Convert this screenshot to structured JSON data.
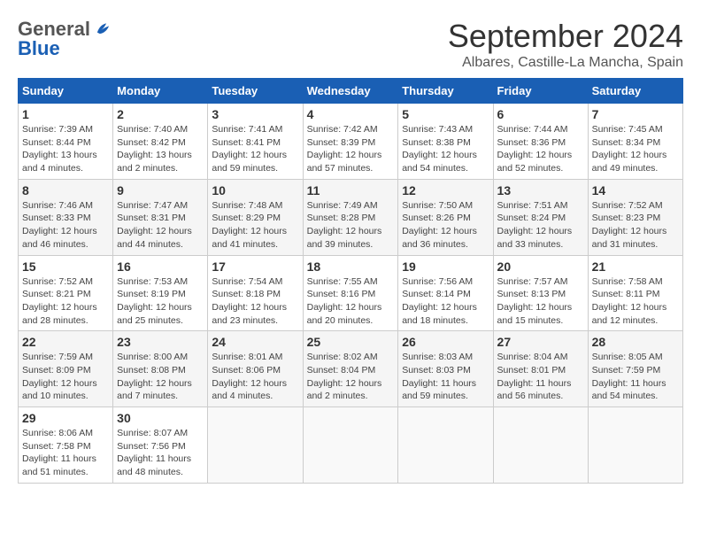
{
  "header": {
    "logo_general": "General",
    "logo_blue": "Blue",
    "month_title": "September 2024",
    "location": "Albares, Castille-La Mancha, Spain"
  },
  "days_of_week": [
    "Sunday",
    "Monday",
    "Tuesday",
    "Wednesday",
    "Thursday",
    "Friday",
    "Saturday"
  ],
  "weeks": [
    [
      {
        "day": "1",
        "sunrise": "7:39 AM",
        "sunset": "8:44 PM",
        "daylight": "13 hours and 4 minutes."
      },
      {
        "day": "2",
        "sunrise": "7:40 AM",
        "sunset": "8:42 PM",
        "daylight": "13 hours and 2 minutes."
      },
      {
        "day": "3",
        "sunrise": "7:41 AM",
        "sunset": "8:41 PM",
        "daylight": "12 hours and 59 minutes."
      },
      {
        "day": "4",
        "sunrise": "7:42 AM",
        "sunset": "8:39 PM",
        "daylight": "12 hours and 57 minutes."
      },
      {
        "day": "5",
        "sunrise": "7:43 AM",
        "sunset": "8:38 PM",
        "daylight": "12 hours and 54 minutes."
      },
      {
        "day": "6",
        "sunrise": "7:44 AM",
        "sunset": "8:36 PM",
        "daylight": "12 hours and 52 minutes."
      },
      {
        "day": "7",
        "sunrise": "7:45 AM",
        "sunset": "8:34 PM",
        "daylight": "12 hours and 49 minutes."
      }
    ],
    [
      {
        "day": "8",
        "sunrise": "7:46 AM",
        "sunset": "8:33 PM",
        "daylight": "12 hours and 46 minutes."
      },
      {
        "day": "9",
        "sunrise": "7:47 AM",
        "sunset": "8:31 PM",
        "daylight": "12 hours and 44 minutes."
      },
      {
        "day": "10",
        "sunrise": "7:48 AM",
        "sunset": "8:29 PM",
        "daylight": "12 hours and 41 minutes."
      },
      {
        "day": "11",
        "sunrise": "7:49 AM",
        "sunset": "8:28 PM",
        "daylight": "12 hours and 39 minutes."
      },
      {
        "day": "12",
        "sunrise": "7:50 AM",
        "sunset": "8:26 PM",
        "daylight": "12 hours and 36 minutes."
      },
      {
        "day": "13",
        "sunrise": "7:51 AM",
        "sunset": "8:24 PM",
        "daylight": "12 hours and 33 minutes."
      },
      {
        "day": "14",
        "sunrise": "7:52 AM",
        "sunset": "8:23 PM",
        "daylight": "12 hours and 31 minutes."
      }
    ],
    [
      {
        "day": "15",
        "sunrise": "7:52 AM",
        "sunset": "8:21 PM",
        "daylight": "12 hours and 28 minutes."
      },
      {
        "day": "16",
        "sunrise": "7:53 AM",
        "sunset": "8:19 PM",
        "daylight": "12 hours and 25 minutes."
      },
      {
        "day": "17",
        "sunrise": "7:54 AM",
        "sunset": "8:18 PM",
        "daylight": "12 hours and 23 minutes."
      },
      {
        "day": "18",
        "sunrise": "7:55 AM",
        "sunset": "8:16 PM",
        "daylight": "12 hours and 20 minutes."
      },
      {
        "day": "19",
        "sunrise": "7:56 AM",
        "sunset": "8:14 PM",
        "daylight": "12 hours and 18 minutes."
      },
      {
        "day": "20",
        "sunrise": "7:57 AM",
        "sunset": "8:13 PM",
        "daylight": "12 hours and 15 minutes."
      },
      {
        "day": "21",
        "sunrise": "7:58 AM",
        "sunset": "8:11 PM",
        "daylight": "12 hours and 12 minutes."
      }
    ],
    [
      {
        "day": "22",
        "sunrise": "7:59 AM",
        "sunset": "8:09 PM",
        "daylight": "12 hours and 10 minutes."
      },
      {
        "day": "23",
        "sunrise": "8:00 AM",
        "sunset": "8:08 PM",
        "daylight": "12 hours and 7 minutes."
      },
      {
        "day": "24",
        "sunrise": "8:01 AM",
        "sunset": "8:06 PM",
        "daylight": "12 hours and 4 minutes."
      },
      {
        "day": "25",
        "sunrise": "8:02 AM",
        "sunset": "8:04 PM",
        "daylight": "12 hours and 2 minutes."
      },
      {
        "day": "26",
        "sunrise": "8:03 AM",
        "sunset": "8:03 PM",
        "daylight": "11 hours and 59 minutes."
      },
      {
        "day": "27",
        "sunrise": "8:04 AM",
        "sunset": "8:01 PM",
        "daylight": "11 hours and 56 minutes."
      },
      {
        "day": "28",
        "sunrise": "8:05 AM",
        "sunset": "7:59 PM",
        "daylight": "11 hours and 54 minutes."
      }
    ],
    [
      {
        "day": "29",
        "sunrise": "8:06 AM",
        "sunset": "7:58 PM",
        "daylight": "11 hours and 51 minutes."
      },
      {
        "day": "30",
        "sunrise": "8:07 AM",
        "sunset": "7:56 PM",
        "daylight": "11 hours and 48 minutes."
      },
      null,
      null,
      null,
      null,
      null
    ]
  ],
  "labels": {
    "sunrise": "Sunrise:",
    "sunset": "Sunset:",
    "daylight": "Daylight hours"
  }
}
